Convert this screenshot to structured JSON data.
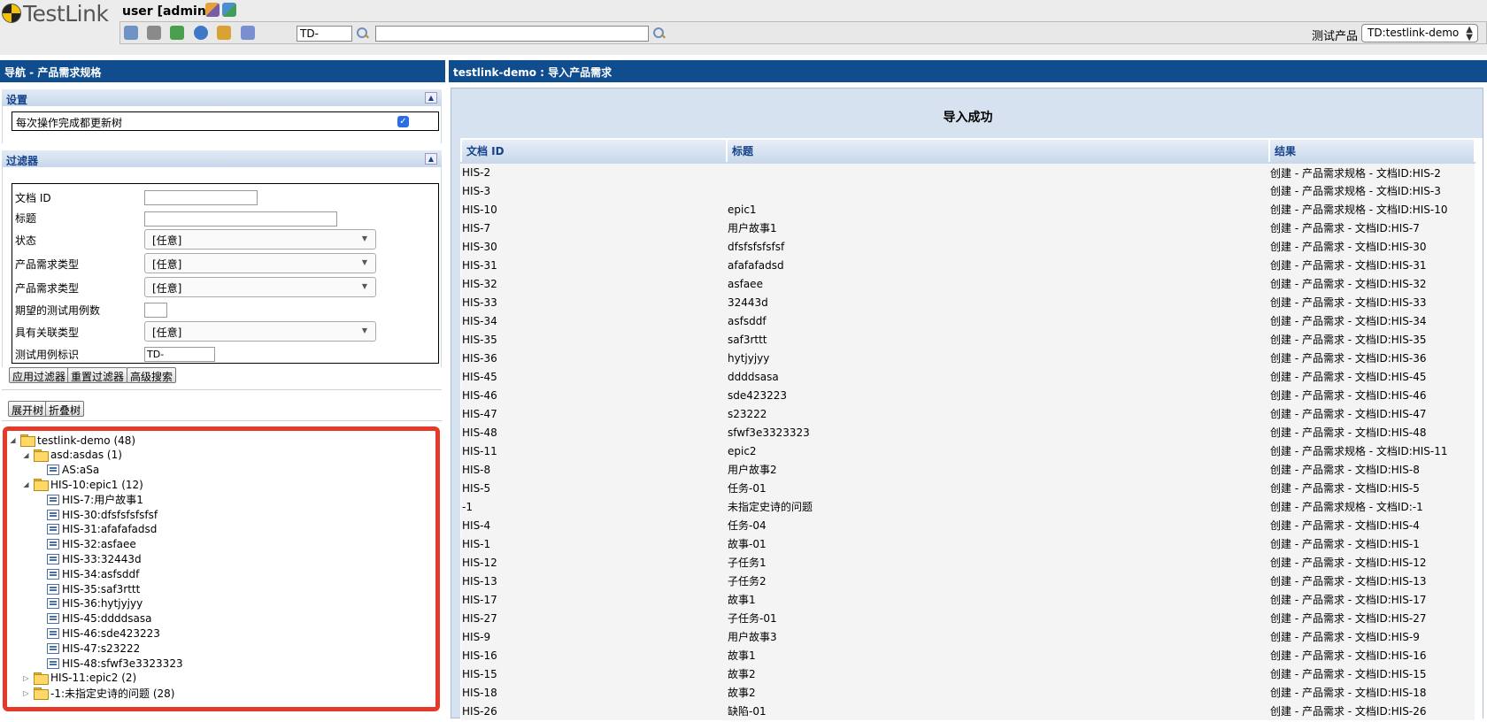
{
  "app": {
    "logo_text": "TestLink",
    "user_label": "user [admin]",
    "tc_prefix_value": "TD-",
    "search_value": "",
    "product_label": "测试产品",
    "product_value": "TD:testlink-demo"
  },
  "left": {
    "title": "导航 - 产品需求规格",
    "settings_header": "设置",
    "settings_option": "每次操作完成都更新树",
    "filter_header": "过滤器",
    "filters": {
      "doc_id_label": "文档 ID",
      "title_label": "标题",
      "status_label": "状态",
      "status_value": "[任意]",
      "req_type_label": "产品需求类型",
      "req_type_value": "[任意]",
      "req_type2_label": "产品需求类型",
      "req_type2_value": "[任意]",
      "expected_tc_label": "期望的测试用例数",
      "relation_label": "具有关联类型",
      "relation_value": "[任意]",
      "tc_id_label": "测试用例标识",
      "tc_id_value": "TD-"
    },
    "buttons": {
      "apply": "应用过滤器",
      "reset": "重置过滤器",
      "advanced": "高级搜索",
      "expand": "展开树",
      "collapse": "折叠树"
    },
    "tree": [
      {
        "label": "testlink-demo (48)",
        "level": 0,
        "type": "folder",
        "toggle": "open"
      },
      {
        "label": "asd:asdas (1)",
        "level": 1,
        "type": "folder",
        "toggle": "open"
      },
      {
        "label": "AS:aSa",
        "level": 2,
        "type": "req",
        "toggle": ""
      },
      {
        "label": "HIS-10:epic1 (12)",
        "level": 1,
        "type": "folder",
        "toggle": "open"
      },
      {
        "label": "HIS-7:用户故事1",
        "level": 2,
        "type": "req",
        "toggle": ""
      },
      {
        "label": "HIS-30:dfsfsfsfsfsf",
        "level": 2,
        "type": "req",
        "toggle": ""
      },
      {
        "label": "HIS-31:afafafadsd",
        "level": 2,
        "type": "req",
        "toggle": ""
      },
      {
        "label": "HIS-32:asfaee",
        "level": 2,
        "type": "req",
        "toggle": ""
      },
      {
        "label": "HIS-33:32443d",
        "level": 2,
        "type": "req",
        "toggle": ""
      },
      {
        "label": "HIS-34:asfsddf",
        "level": 2,
        "type": "req",
        "toggle": ""
      },
      {
        "label": "HIS-35:saf3rttt",
        "level": 2,
        "type": "req",
        "toggle": ""
      },
      {
        "label": "HIS-36:hytjyjyy",
        "level": 2,
        "type": "req",
        "toggle": ""
      },
      {
        "label": "HIS-45:ddddsasa",
        "level": 2,
        "type": "req",
        "toggle": ""
      },
      {
        "label": "HIS-46:sde423223",
        "level": 2,
        "type": "req",
        "toggle": ""
      },
      {
        "label": "HIS-47:s23222",
        "level": 2,
        "type": "req",
        "toggle": ""
      },
      {
        "label": "HIS-48:sfwf3e3323323",
        "level": 2,
        "type": "req",
        "toggle": ""
      },
      {
        "label": "HIS-11:epic2 (2)",
        "level": 1,
        "type": "folder",
        "toggle": "closed"
      },
      {
        "label": "-1:未指定史诗的问题 (28)",
        "level": 1,
        "type": "folder",
        "toggle": "closed"
      }
    ]
  },
  "right": {
    "title": "testlink-demo : 导入产品需求",
    "success_text": "导入成功",
    "columns": [
      "文档 ID",
      "标题",
      "结果"
    ],
    "rows": [
      [
        "HIS-2",
        "",
        "创建 - 产品需求规格 - 文档ID:HIS-2"
      ],
      [
        "HIS-3",
        "",
        "创建 - 产品需求规格 - 文档ID:HIS-3"
      ],
      [
        "HIS-10",
        "epic1",
        "创建 - 产品需求规格 - 文档ID:HIS-10"
      ],
      [
        "HIS-7",
        "用户故事1",
        "创建 - 产品需求 - 文档ID:HIS-7"
      ],
      [
        "HIS-30",
        "dfsfsfsfsfsf",
        "创建 - 产品需求 - 文档ID:HIS-30"
      ],
      [
        "HIS-31",
        "afafafadsd",
        "创建 - 产品需求 - 文档ID:HIS-31"
      ],
      [
        "HIS-32",
        "asfaee",
        "创建 - 产品需求 - 文档ID:HIS-32"
      ],
      [
        "HIS-33",
        "32443d",
        "创建 - 产品需求 - 文档ID:HIS-33"
      ],
      [
        "HIS-34",
        "asfsddf",
        "创建 - 产品需求 - 文档ID:HIS-34"
      ],
      [
        "HIS-35",
        "saf3rttt",
        "创建 - 产品需求 - 文档ID:HIS-35"
      ],
      [
        "HIS-36",
        "hytjyjyy",
        "创建 - 产品需求 - 文档ID:HIS-36"
      ],
      [
        "HIS-45",
        "ddddsasa",
        "创建 - 产品需求 - 文档ID:HIS-45"
      ],
      [
        "HIS-46",
        "sde423223",
        "创建 - 产品需求 - 文档ID:HIS-46"
      ],
      [
        "HIS-47",
        "s23222",
        "创建 - 产品需求 - 文档ID:HIS-47"
      ],
      [
        "HIS-48",
        "sfwf3e3323323",
        "创建 - 产品需求 - 文档ID:HIS-48"
      ],
      [
        "HIS-11",
        "epic2",
        "创建 - 产品需求规格 - 文档ID:HIS-11"
      ],
      [
        "HIS-8",
        "用户故事2",
        "创建 - 产品需求 - 文档ID:HIS-8"
      ],
      [
        "HIS-5",
        "任务-01",
        "创建 - 产品需求 - 文档ID:HIS-5"
      ],
      [
        "-1",
        "未指定史诗的问题",
        "创建 - 产品需求规格 - 文档ID:-1"
      ],
      [
        "HIS-4",
        "任务-04",
        "创建 - 产品需求 - 文档ID:HIS-4"
      ],
      [
        "HIS-1",
        "故事-01",
        "创建 - 产品需求 - 文档ID:HIS-1"
      ],
      [
        "HIS-12",
        "子任务1",
        "创建 - 产品需求 - 文档ID:HIS-12"
      ],
      [
        "HIS-13",
        "子任务2",
        "创建 - 产品需求 - 文档ID:HIS-13"
      ],
      [
        "HIS-17",
        "故事1",
        "创建 - 产品需求 - 文档ID:HIS-17"
      ],
      [
        "HIS-27",
        "子任务-01",
        "创建 - 产品需求 - 文档ID:HIS-27"
      ],
      [
        "HIS-9",
        "用户故事3",
        "创建 - 产品需求 - 文档ID:HIS-9"
      ],
      [
        "HIS-16",
        "故事1",
        "创建 - 产品需求 - 文档ID:HIS-16"
      ],
      [
        "HIS-15",
        "故事2",
        "创建 - 产品需求 - 文档ID:HIS-15"
      ],
      [
        "HIS-18",
        "故事2",
        "创建 - 产品需求 - 文档ID:HIS-18"
      ],
      [
        "HIS-26",
        "缺陷-01",
        "创建 - 产品需求 - 文档ID:HIS-26"
      ]
    ]
  },
  "colors": {
    "panel_title_bg": "#0f4d8e",
    "header_text": "#15428b",
    "tree_highlight_border": "#e53a2a",
    "content_bg": "#d6e2ef"
  },
  "icons": [
    "testlink-logo-icon",
    "user-edit-icon",
    "user-manage-icon",
    "desktop-icon",
    "cart-icon",
    "tree-icon",
    "user-icon",
    "broom-icon",
    "plug-icon",
    "search-icon",
    "folder-icon",
    "requirement-icon"
  ]
}
